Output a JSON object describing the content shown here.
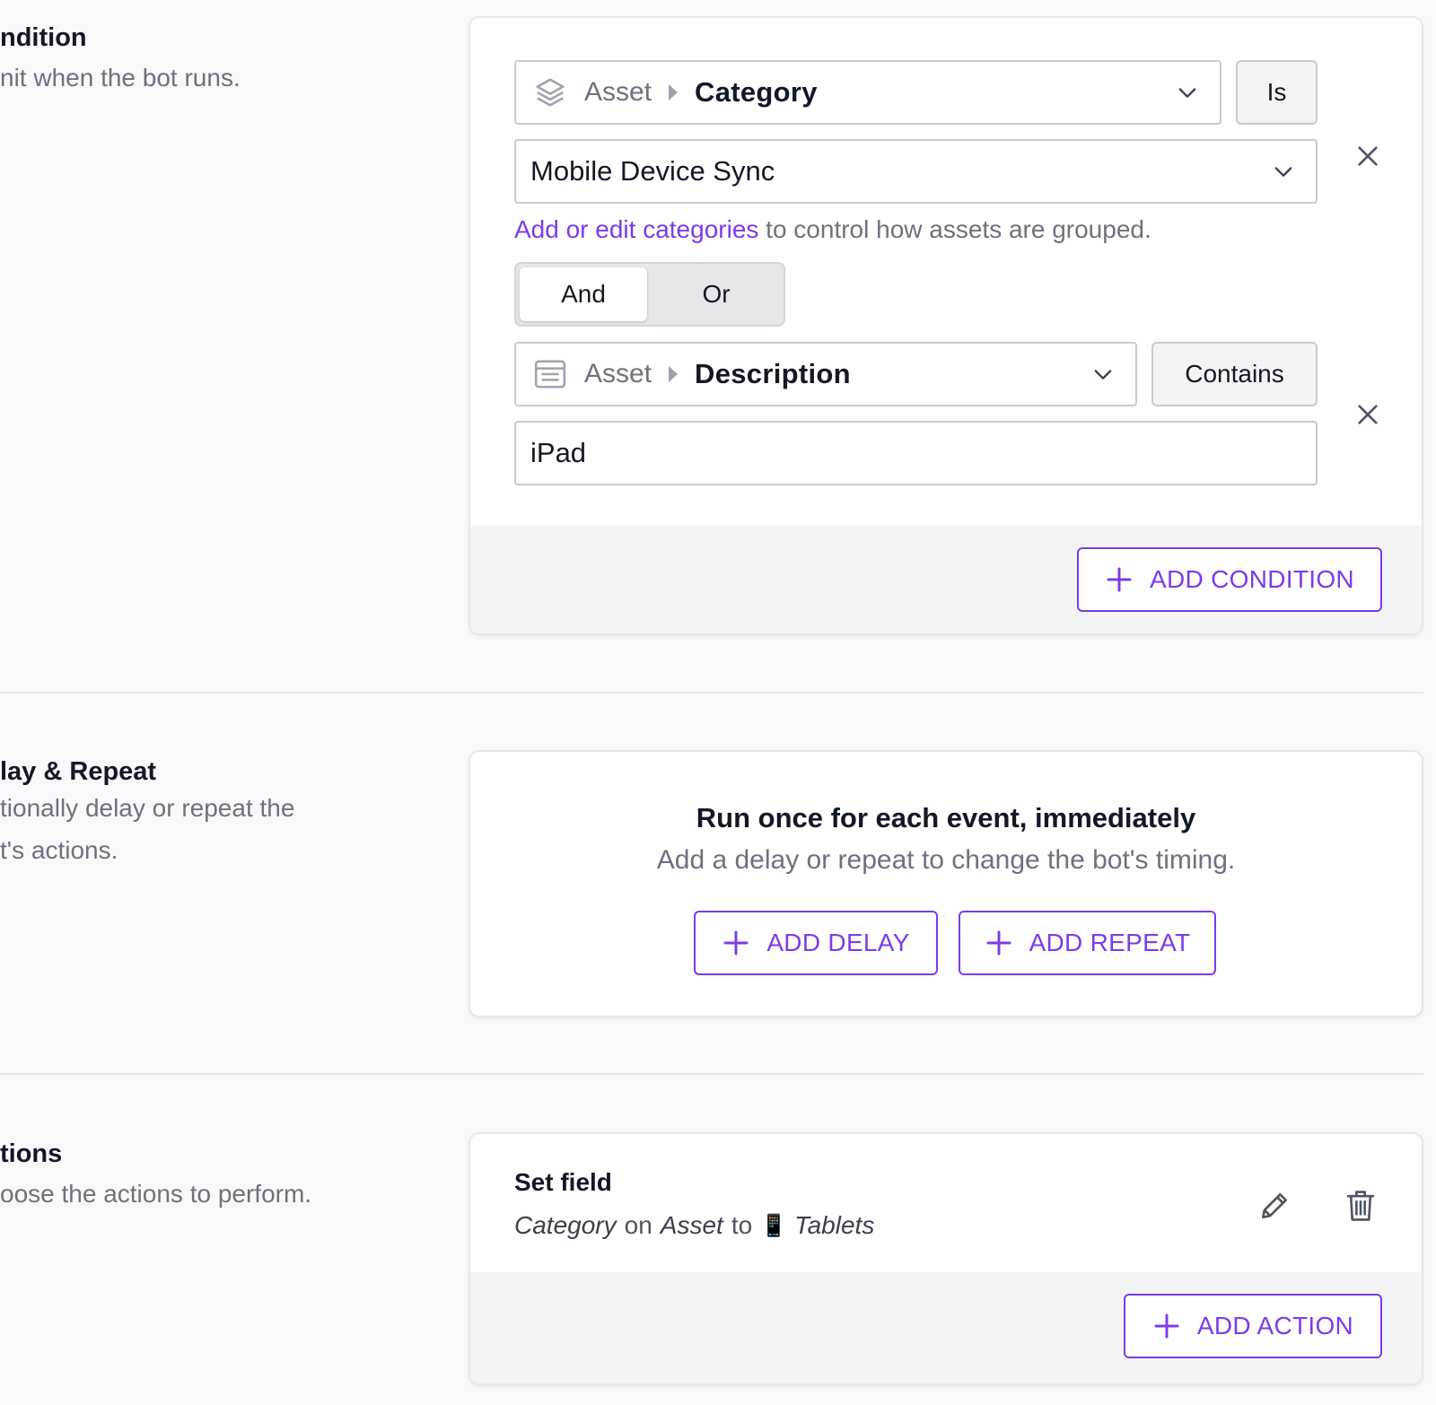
{
  "condition_section": {
    "title": "ndition",
    "description": "nit when the bot runs."
  },
  "condition_card": {
    "rule1": {
      "field_icon": "layers-icon",
      "entity": "Asset",
      "field": "Category",
      "operator": "Is",
      "value": "Mobile Device Sync"
    },
    "help_link": "Add or edit categories",
    "help_text": " to control how assets are grouped.",
    "logic_toggle": {
      "and_label": "And",
      "or_label": "Or",
      "selected": "And"
    },
    "rule2": {
      "field_icon": "text-field-icon",
      "entity": "Asset",
      "field": "Description",
      "operator": "Contains",
      "value": "iPad"
    },
    "add_condition_label": "ADD CONDITION"
  },
  "delay_section": {
    "title": "lay & Repeat",
    "description_line1": "tionally delay or repeat the",
    "description_line2": "t's actions."
  },
  "delay_card": {
    "title": "Run once for each event, immediately",
    "subtitle": "Add a delay or repeat to change the bot's timing.",
    "add_delay_label": "ADD DELAY",
    "add_repeat_label": "ADD REPEAT"
  },
  "actions_section": {
    "title": "tions",
    "description": "oose the actions to perform."
  },
  "actions_card": {
    "action_title": "Set field",
    "action_field": "Category",
    "action_on": "on",
    "action_entity": "Asset",
    "action_to": "to",
    "action_value_emoji": "📱",
    "action_value": "Tablets",
    "add_action_label": "ADD ACTION"
  },
  "colors": {
    "accent": "#7c3aed",
    "muted_text": "#6b7280",
    "border": "#c7cbd1",
    "footer_bg": "#f3f4f6"
  }
}
